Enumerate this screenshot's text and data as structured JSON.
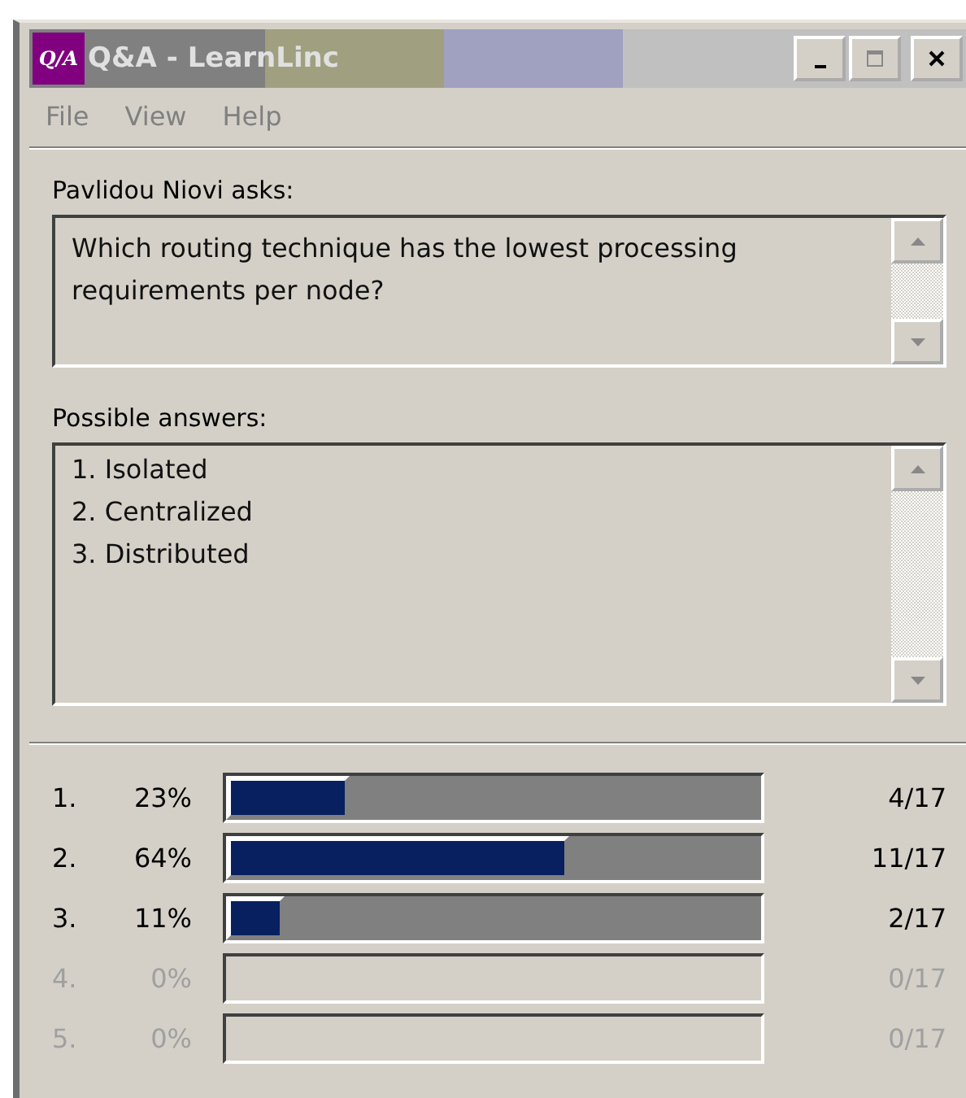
{
  "window": {
    "title": "Q&A - LearnLinc",
    "logo": "Q/A"
  },
  "menu": [
    "File",
    "View",
    "Help"
  ],
  "question": {
    "label": "Pavlidou Niovi asks:",
    "text": "Which routing technique has the lowest processing requirements per node?"
  },
  "answers": {
    "label": "Possible answers:",
    "items": [
      "1. Isolated",
      "2. Centralized",
      "3. Distributed"
    ]
  },
  "results": [
    {
      "number": "1.",
      "percent": "23%",
      "level": 0.23,
      "count": "4/17",
      "disabled": false
    },
    {
      "number": "2.",
      "percent": "64%",
      "level": 0.64,
      "count": "11/17",
      "disabled": false
    },
    {
      "number": "3.",
      "percent": "11%",
      "level": 0.11,
      "count": "2/17",
      "disabled": false
    },
    {
      "number": "4.",
      "percent": "0%",
      "count": "0/17",
      "disabled": true
    },
    {
      "number": "5.",
      "percent": "0%",
      "count": "0/17",
      "disabled": true
    }
  ]
}
